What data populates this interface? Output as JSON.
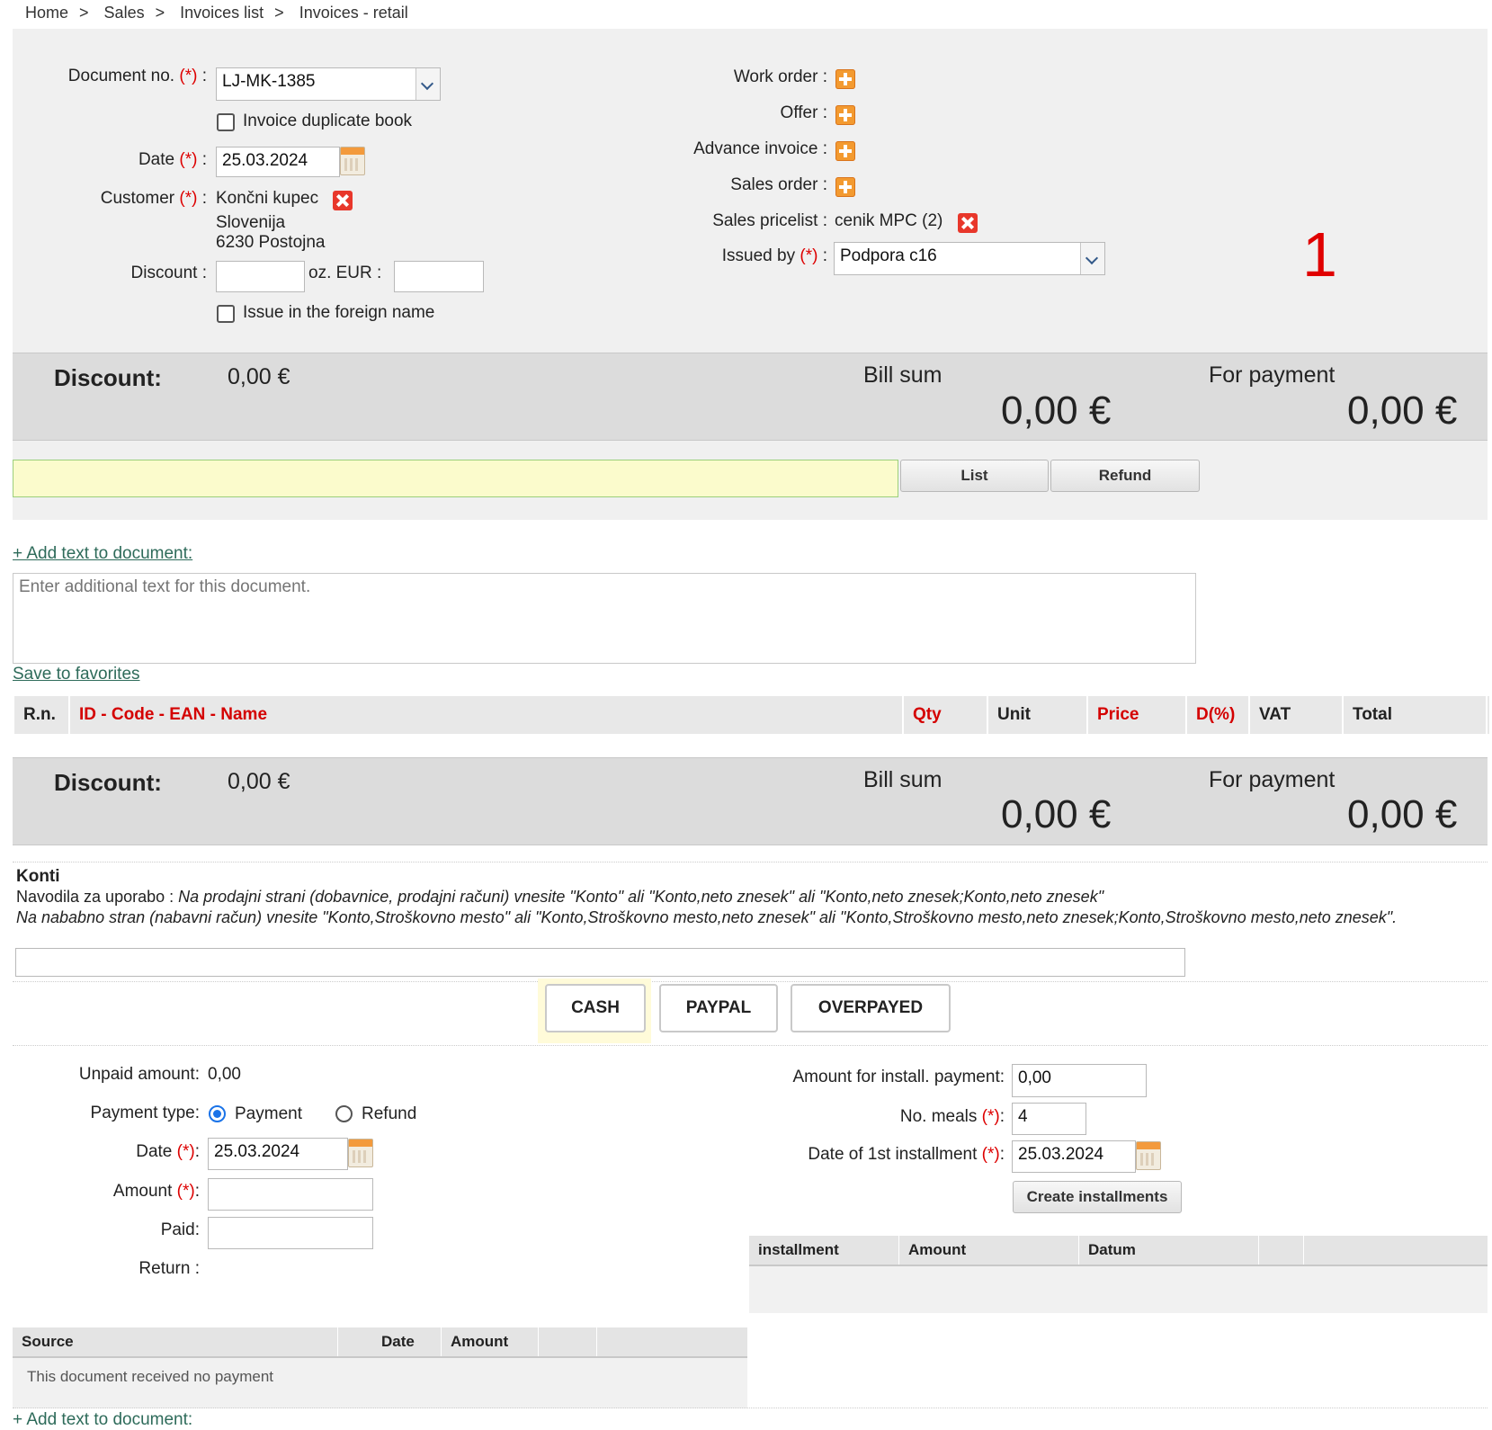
{
  "breadcrumb": [
    "Home",
    "Sales",
    "Invoices list",
    "Invoices - retail"
  ],
  "breadcrumb_sep": ">",
  "form": {
    "document_no_label": "Document no.",
    "required_mark": "(*)",
    "colon": ":",
    "document_no_value": "LJ-MK-1385",
    "invoice_duplicate_label": "Invoice duplicate book",
    "date_label": "Date",
    "date_value": "25.03.2024",
    "customer_label": "Customer",
    "customer_name": "Končni kupec",
    "customer_country": "Slovenija",
    "customer_city": "6230 Postojna",
    "discount_label": "Discount :",
    "oz_eur_label": "oz. EUR :",
    "foreign_name_label": "Issue in the foreign name",
    "work_order_label": "Work order :",
    "offer_label": "Offer :",
    "advance_invoice_label": "Advance invoice :",
    "sales_order_label": "Sales order :",
    "sales_pricelist_label": "Sales pricelist :",
    "sales_pricelist_value": "cenik MPC (2)",
    "issued_by_label": "Issued by",
    "issued_by_value": "Podpora c16",
    "annotation_number": "1"
  },
  "summary": {
    "discount_label": "Discount:",
    "discount_value": "0,00 €",
    "bill_sum_label": "Bill sum",
    "bill_sum_value": "0,00 €",
    "for_payment_label": "For payment",
    "for_payment_value": "0,00 €"
  },
  "search": {
    "list_button": "List",
    "refund_button": "Refund"
  },
  "text_section": {
    "add_text_link": "+ Add text to document:",
    "placeholder": "Enter additional text for this document.",
    "save_favorites_link": "Save to favorites"
  },
  "items_table": {
    "columns": [
      "R.n.",
      "ID - Code - EAN - Name",
      "Qty",
      "Unit",
      "Price",
      "D(%)",
      "VAT",
      "Total"
    ]
  },
  "konti": {
    "title": "Konti",
    "instructions_prefix": "Navodila za uporabo : ",
    "instructions_1": "Na prodajni strani (dobavnice, prodajni računi) vnesite \"Konto\" ali \"Konto,neto znesek\" ali \"Konto,neto znesek;Konto,neto znesek\"",
    "instructions_2": "Na nababno stran (nabavni račun) vnesite \"Konto,Stroškovno mesto\" ali \"Konto,Stroškovno mesto,neto znesek\" ali \"Konto,Stroškovno mesto,neto znesek;Konto,Stroškovno mesto,neto znesek\"."
  },
  "payment_methods": [
    "CASH",
    "PAYPAL",
    "OVERPAYED"
  ],
  "payment": {
    "unpaid_label": "Unpaid amount:",
    "unpaid_value": "0,00",
    "payment_type_label": "Payment type:",
    "payment_option": "Payment",
    "refund_option": "Refund",
    "date_label": "Date",
    "date_value": "25.03.2024",
    "amount_label": "Amount",
    "paid_label": "Paid:",
    "return_label": "Return :"
  },
  "installments": {
    "amount_label": "Amount for install. payment:",
    "amount_value": "0,00",
    "meals_label": "No. meals",
    "meals_value": "4",
    "first_date_label": "Date of 1st installment",
    "first_date_value": "25.03.2024",
    "create_button": "Create installments",
    "columns": [
      "installment",
      "Amount",
      "Datum"
    ]
  },
  "payments_table": {
    "columns": [
      "Source",
      "Date",
      "Amount"
    ],
    "empty_text": "This document received no payment"
  },
  "bottom_link": "+ Add text to document:"
}
